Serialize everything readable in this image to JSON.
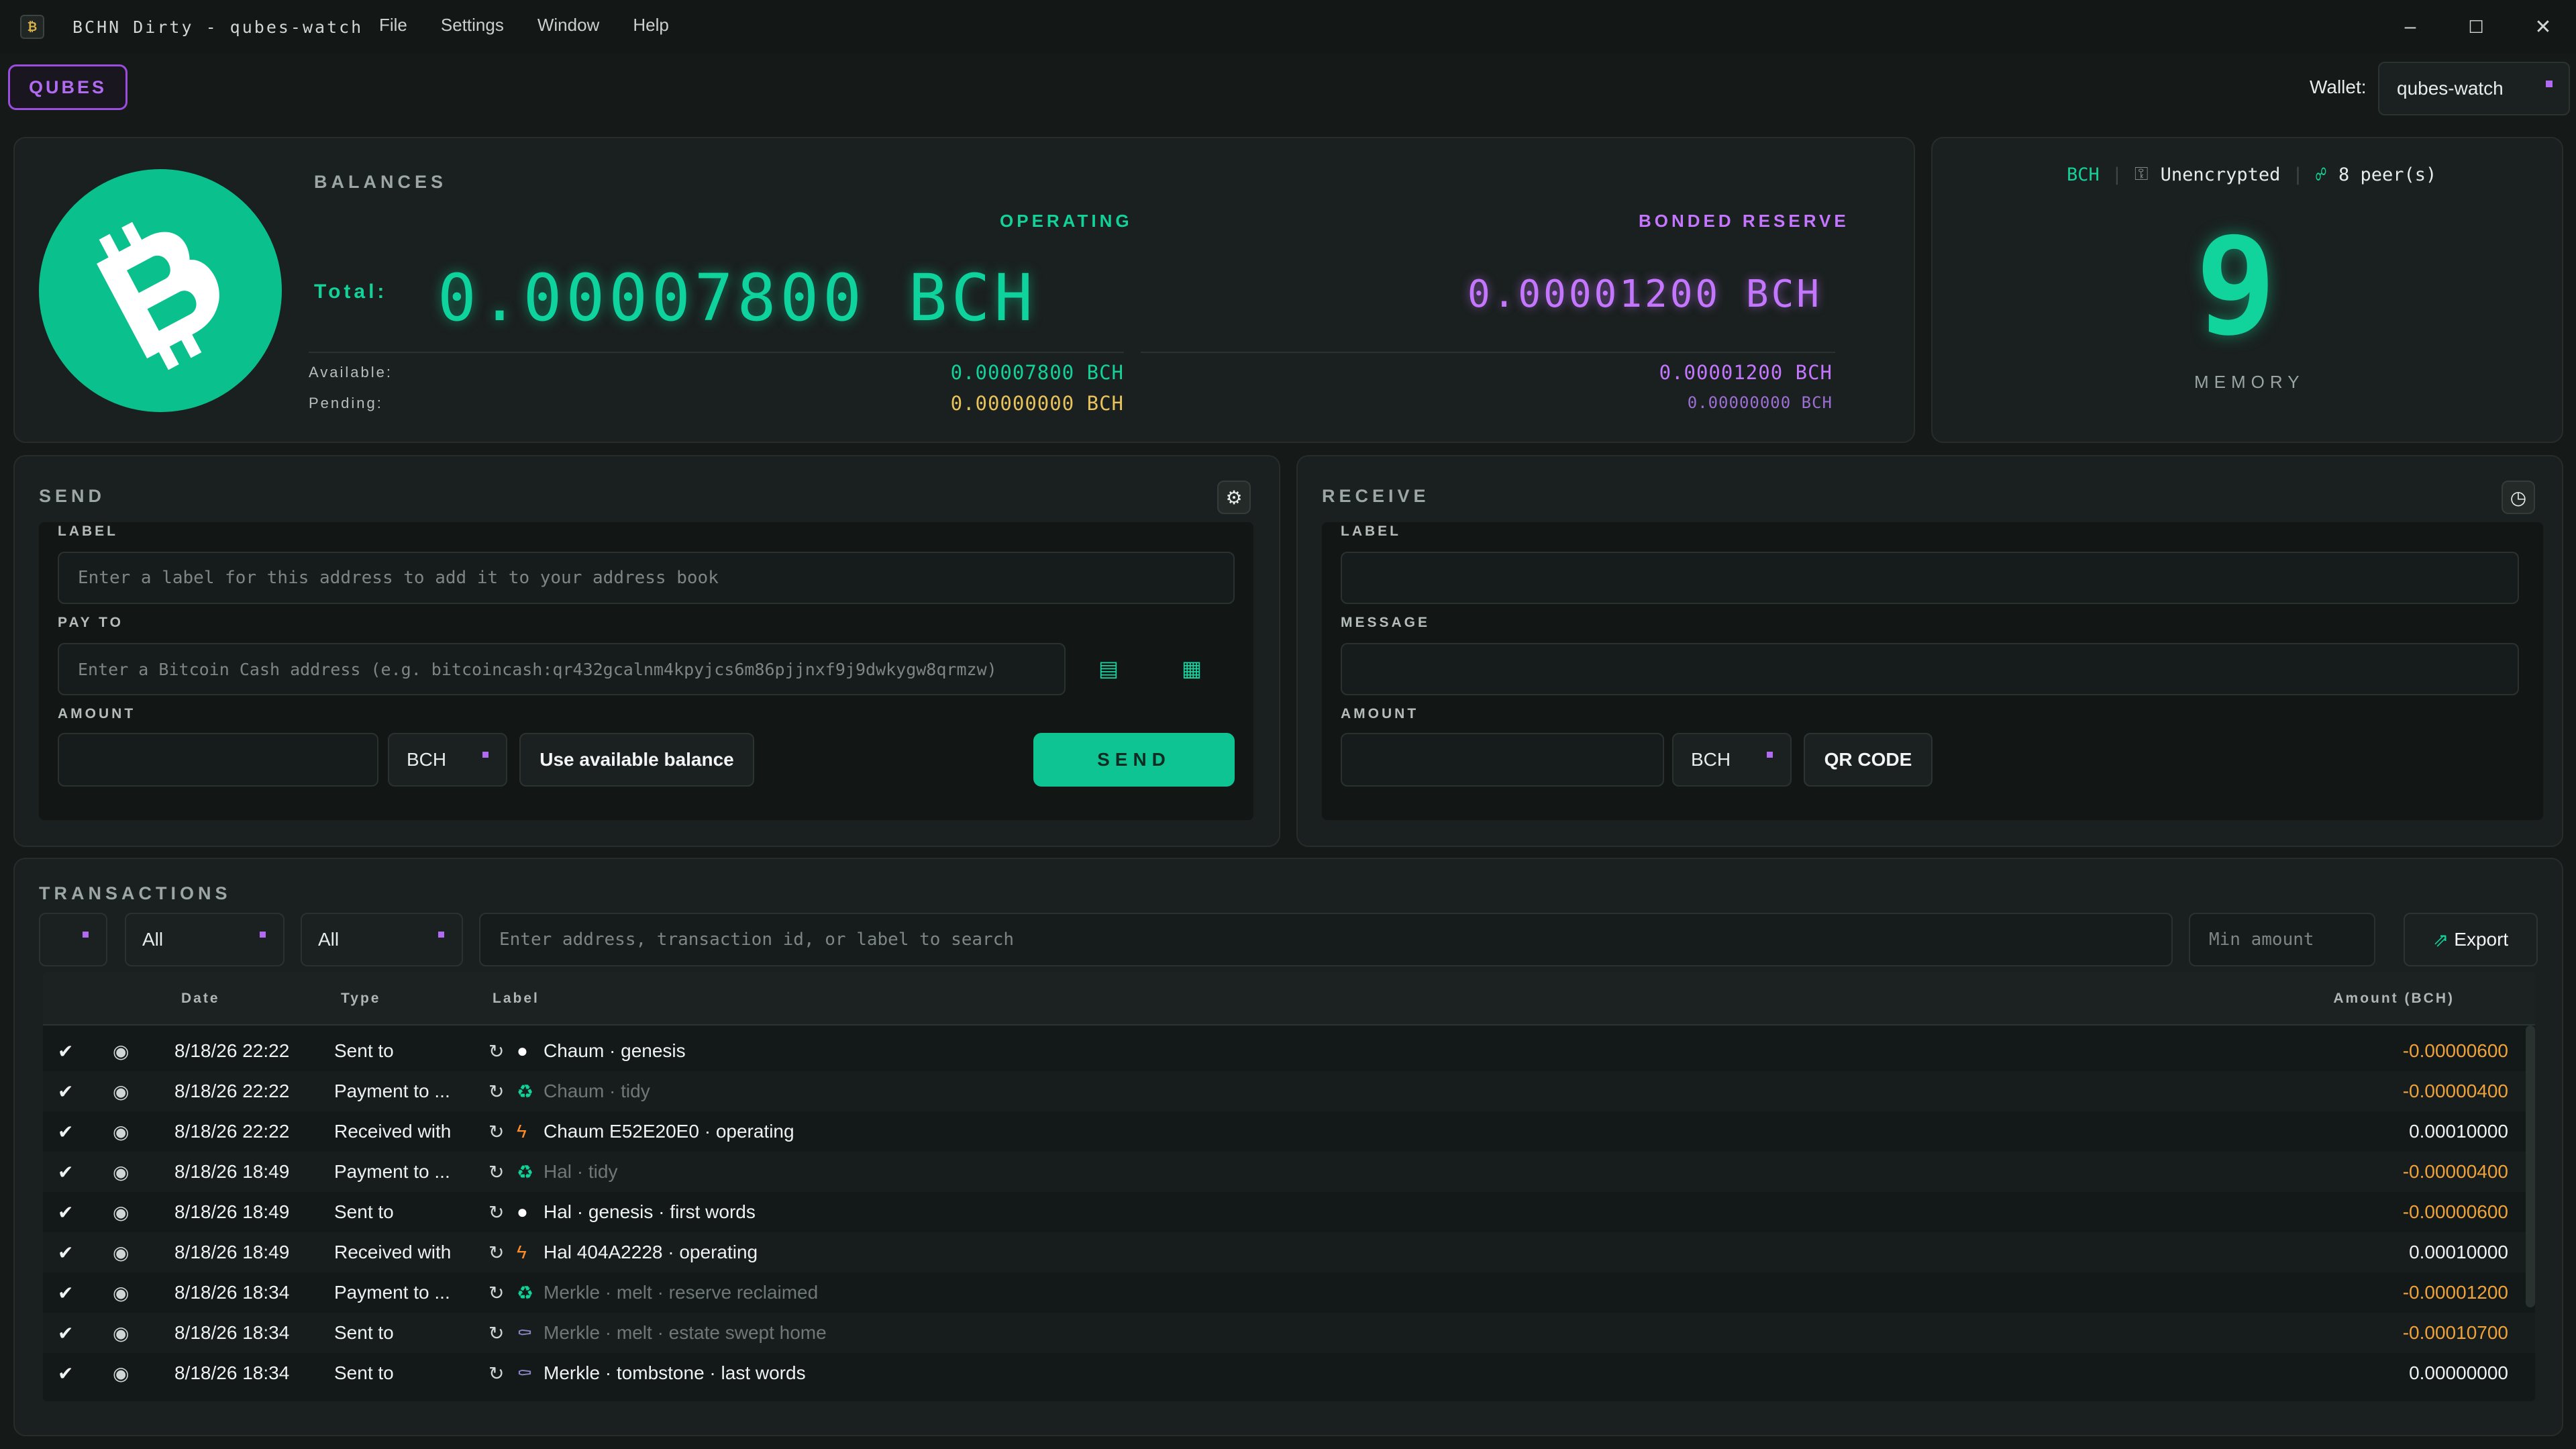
{
  "window": {
    "title": "BCHN Dirty - qubes-watch",
    "menu": [
      "File",
      "Settings",
      "Window",
      "Help"
    ]
  },
  "toolbar": {
    "qubes_label": "QUBES",
    "wallet_label": "Wallet:",
    "wallet_value": "qubes-watch"
  },
  "balances": {
    "title": "BALANCES",
    "operating_head": "OPERATING",
    "reserve_head": "BONDED RESERVE",
    "total_label": "Total:",
    "total_operating": "0.00007800 BCH",
    "total_reserve": "0.00001200 BCH",
    "available_label": "Available:",
    "pending_label": "Pending:",
    "available_operating": "0.00007800 BCH",
    "pending_operating": "0.00000000 BCH",
    "available_reserve": "0.00001200 BCH",
    "pending_reserve": "0.00000000 BCH"
  },
  "status": {
    "network": "BCH",
    "encryption": "Unencrypted",
    "peers": "8 peer(s)",
    "memory_value": "9",
    "memory_label": "MEMORY"
  },
  "send": {
    "title": "SEND",
    "label_field_label": "LABEL",
    "label_placeholder": "Enter a label for this address to add it to your address book",
    "payto_label": "PAY TO",
    "payto_placeholder": "Enter a Bitcoin Cash address (e.g. bitcoincash:qr432gcalnm4kpyjcs6m86pjjnxf9j9dwkygw8qrmzw)",
    "amount_label": "AMOUNT",
    "unit": "BCH",
    "use_balance_label": "Use available balance",
    "send_label": "SEND"
  },
  "receive": {
    "title": "RECEIVE",
    "label_field_label": "LABEL",
    "message_label": "MESSAGE",
    "amount_label": "AMOUNT",
    "unit": "BCH",
    "qr_label": "QR CODE"
  },
  "transactions": {
    "title": "TRANSACTIONS",
    "filter_type": "All",
    "filter_date": "All",
    "search_placeholder": "Enter address, transaction id, or label to search",
    "min_amount_placeholder": "Min amount",
    "export_label": "Export",
    "columns": [
      "Date",
      "Type",
      "Label",
      "Amount (BCH)"
    ],
    "rows": [
      {
        "date": "8/18/26 22:22",
        "type": "Sent to",
        "icon": "dot",
        "label": "Chaum · genesis",
        "amount": "-0.00000600",
        "dim": false,
        "neg": true
      },
      {
        "date": "8/18/26 22:22",
        "type": "Payment to ...",
        "icon": "recycle",
        "label": "Chaum · tidy",
        "amount": "-0.00000400",
        "dim": true,
        "neg": true
      },
      {
        "date": "8/18/26 22:22",
        "type": "Received with",
        "icon": "bolt",
        "label": "Chaum E52E20E0 · operating",
        "amount": "0.00010000",
        "dim": false,
        "neg": false
      },
      {
        "date": "8/18/26 18:49",
        "type": "Payment to ...",
        "icon": "recycle",
        "label": "Hal · tidy",
        "amount": "-0.00000400",
        "dim": true,
        "neg": true
      },
      {
        "date": "8/18/26 18:49",
        "type": "Sent to",
        "icon": "dot",
        "label": "Hal · genesis · first words",
        "amount": "-0.00000600",
        "dim": false,
        "neg": true
      },
      {
        "date": "8/18/26 18:49",
        "type": "Received with",
        "icon": "bolt",
        "label": "Hal 404A2228 · operating",
        "amount": "0.00010000",
        "dim": false,
        "neg": false
      },
      {
        "date": "8/18/26 18:34",
        "type": "Payment to ...",
        "icon": "recycle",
        "label": "Merkle · melt · reserve reclaimed",
        "amount": "-0.00001200",
        "dim": true,
        "neg": true
      },
      {
        "date": "8/18/26 18:34",
        "type": "Sent to",
        "icon": "tomb",
        "label": "Merkle · melt · estate swept home",
        "amount": "-0.00010700",
        "dim": true,
        "neg": true
      },
      {
        "date": "8/18/26 18:34",
        "type": "Sent to",
        "icon": "tomb",
        "label": "Merkle · tombstone · last words",
        "amount": "0.00000000",
        "dim": false,
        "neg": false
      }
    ]
  },
  "colors": {
    "accent_green": "#0fd39c",
    "accent_purple": "#c576ff",
    "pending_yellow": "#e8c25a",
    "negative_orange": "#f0a23a"
  }
}
